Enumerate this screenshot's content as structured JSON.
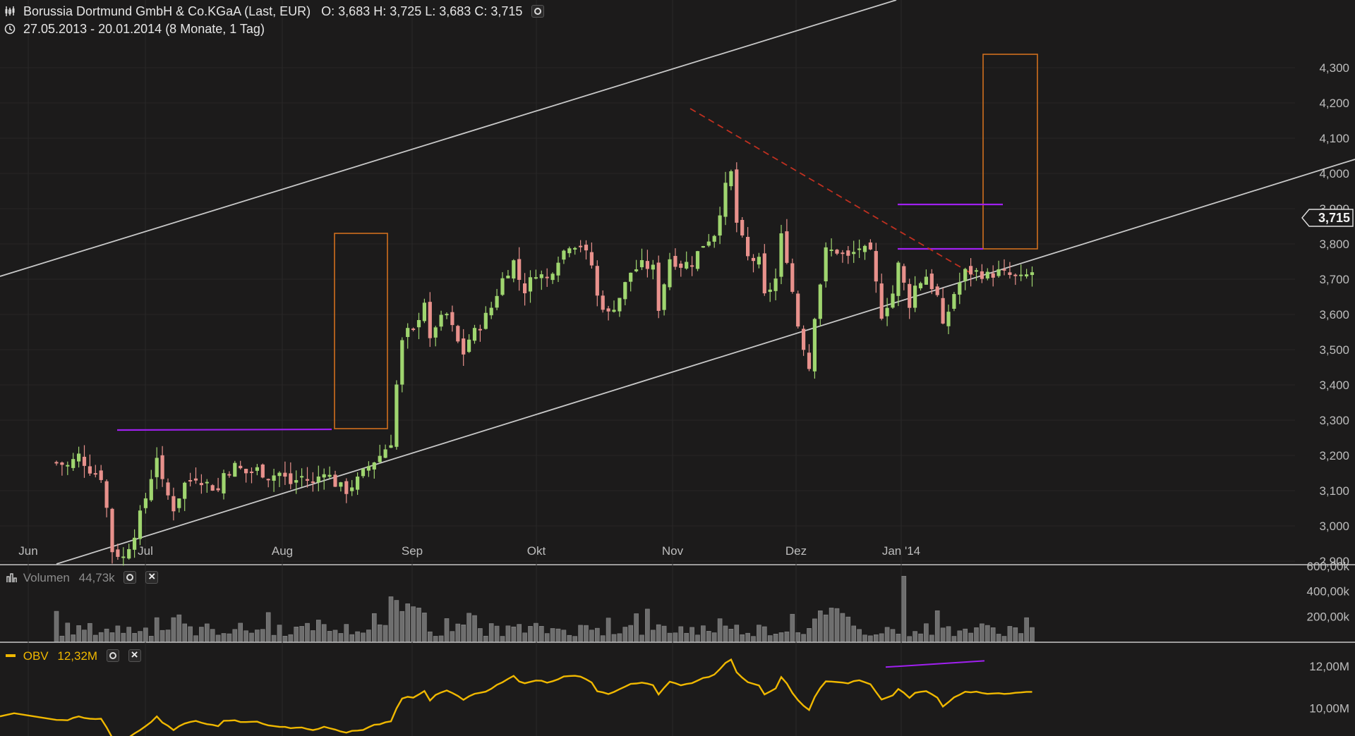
{
  "header": {
    "title": "Borussia Dortmund GmbH & Co.KGaA (Last, EUR)",
    "ohlc": "O: 3,683  H: 3,725  L: 3,683  C: 3,715",
    "range": "27.05.2013 - 20.01.2014 (8 Monate, 1 Tag)"
  },
  "price_tag": "3,715",
  "colors": {
    "up": "#9fd56f",
    "down": "#e8918c",
    "channel": "#c8c8c8",
    "box": "#d0701e",
    "purple": "#a020f0",
    "obv": "#f0b800",
    "volume": "#7a7a7a"
  },
  "volume_label": {
    "name": "Volumen",
    "value": "44,73k"
  },
  "obv_label": {
    "name": "OBV",
    "value": "12,32M"
  },
  "chart_data": [
    {
      "type": "candlestick",
      "title": "Borussia Dortmund GmbH & Co.KGaA (Last, EUR)",
      "x_ticks": [
        "Jun",
        "Jul",
        "Aug",
        "Sep",
        "Okt",
        "Nov",
        "Dez",
        "Jan '14"
      ],
      "y_ticks": [
        "2,900",
        "3,000",
        "3,100",
        "3,200",
        "3,300",
        "3,400",
        "3,500",
        "3,600",
        "3,700",
        "3,800",
        "3,900",
        "4,000",
        "4,100",
        "4,200",
        "4,300"
      ],
      "ylim": [
        2.88,
        4.32
      ],
      "close_path": [
        [
          0,
          3.18
        ],
        [
          2,
          3.17
        ],
        [
          4,
          3.2
        ],
        [
          6,
          3.16
        ],
        [
          8,
          3.14
        ],
        [
          9,
          3.05
        ],
        [
          10,
          2.93
        ],
        [
          12,
          2.91
        ],
        [
          14,
          2.98
        ],
        [
          16,
          3.08
        ],
        [
          18,
          3.2
        ],
        [
          19,
          3.12
        ],
        [
          21,
          3.05
        ],
        [
          23,
          3.12
        ],
        [
          25,
          3.14
        ],
        [
          27,
          3.12
        ],
        [
          29,
          3.1
        ],
        [
          30,
          3.15
        ],
        [
          32,
          3.17
        ],
        [
          34,
          3.15
        ],
        [
          36,
          3.16
        ],
        [
          38,
          3.14
        ],
        [
          40,
          3.15
        ],
        [
          42,
          3.12
        ],
        [
          44,
          3.14
        ],
        [
          46,
          3.12
        ],
        [
          48,
          3.16
        ],
        [
          50,
          3.12
        ],
        [
          52,
          3.1
        ],
        [
          54,
          3.13
        ],
        [
          56,
          3.17
        ],
        [
          58,
          3.2
        ],
        [
          60,
          3.24
        ],
        [
          61,
          3.4
        ],
        [
          62,
          3.52
        ],
        [
          63,
          3.55
        ],
        [
          64,
          3.55
        ],
        [
          66,
          3.64
        ],
        [
          67,
          3.52
        ],
        [
          68,
          3.57
        ],
        [
          70,
          3.6
        ],
        [
          72,
          3.52
        ],
        [
          73,
          3.49
        ],
        [
          74,
          3.53
        ],
        [
          76,
          3.57
        ],
        [
          78,
          3.62
        ],
        [
          80,
          3.7
        ],
        [
          82,
          3.75
        ],
        [
          83,
          3.7
        ],
        [
          84,
          3.67
        ],
        [
          86,
          3.72
        ],
        [
          88,
          3.7
        ],
        [
          90,
          3.76
        ],
        [
          92,
          3.8
        ],
        [
          94,
          3.8
        ],
        [
          96,
          3.74
        ],
        [
          97,
          3.65
        ],
        [
          99,
          3.6
        ],
        [
          101,
          3.65
        ],
        [
          103,
          3.72
        ],
        [
          105,
          3.74
        ],
        [
          107,
          3.73
        ],
        [
          108,
          3.62
        ],
        [
          110,
          3.76
        ],
        [
          112,
          3.74
        ],
        [
          114,
          3.75
        ],
        [
          116,
          3.8
        ],
        [
          118,
          3.83
        ],
        [
          120,
          3.96
        ],
        [
          121,
          4.0
        ],
        [
          122,
          3.86
        ],
        [
          124,
          3.76
        ],
        [
          126,
          3.75
        ],
        [
          127,
          3.65
        ],
        [
          129,
          3.7
        ],
        [
          130,
          3.82
        ],
        [
          131,
          3.76
        ],
        [
          133,
          3.57
        ],
        [
          135,
          3.45
        ],
        [
          136,
          3.6
        ],
        [
          138,
          3.78
        ],
        [
          140,
          3.78
        ],
        [
          142,
          3.76
        ],
        [
          144,
          3.79
        ],
        [
          146,
          3.77
        ],
        [
          148,
          3.6
        ],
        [
          150,
          3.66
        ],
        [
          151,
          3.74
        ],
        [
          153,
          3.63
        ],
        [
          154,
          3.68
        ],
        [
          156,
          3.71
        ],
        [
          158,
          3.65
        ],
        [
          159,
          3.56
        ],
        [
          161,
          3.66
        ],
        [
          163,
          3.72
        ],
        [
          165,
          3.72
        ],
        [
          167,
          3.71
        ],
        [
          169,
          3.72
        ],
        [
          171,
          3.71
        ],
        [
          173,
          3.7
        ],
        [
          175,
          3.72
        ]
      ]
    },
    {
      "type": "bar",
      "title": "Volumen",
      "y_ticks": [
        "200,00k",
        "400,00k",
        "600,00k"
      ],
      "ylim": [
        0,
        600
      ],
      "latest": "44,73k"
    },
    {
      "type": "line",
      "title": "OBV",
      "y_ticks": [
        "10,00M",
        "12,00M"
      ],
      "latest": "12,32M"
    }
  ]
}
